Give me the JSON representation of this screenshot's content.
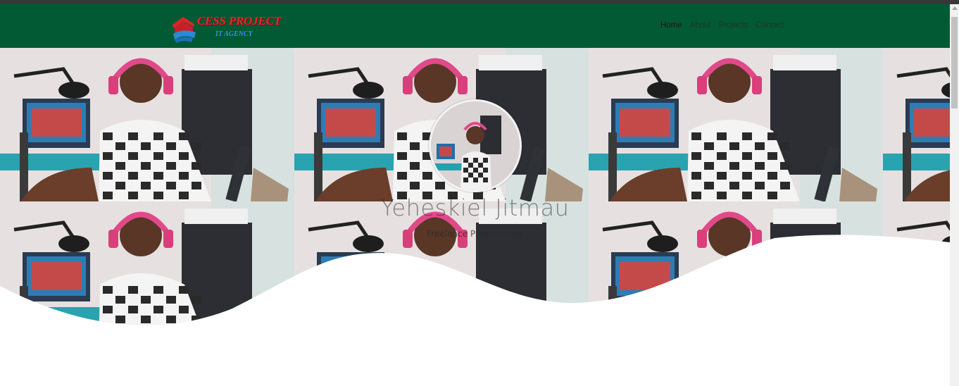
{
  "brand": {
    "title": "CESS PROJECT",
    "subtitle": "IT AGENCY",
    "logo_color": "#e8242a",
    "subtitle_color": "#3a8fe0"
  },
  "navbar": {
    "background": "#015a34",
    "links": [
      {
        "label": "Home",
        "active": true
      },
      {
        "label": "About",
        "active": false
      },
      {
        "label": "Projects",
        "active": false
      },
      {
        "label": "Contact",
        "active": false
      }
    ]
  },
  "hero": {
    "name": "Yeheskiel Jitmau",
    "role": "Freelance Programmer"
  },
  "icons": {
    "avatar": "profile-photo",
    "logo": "house-shield-logo"
  }
}
